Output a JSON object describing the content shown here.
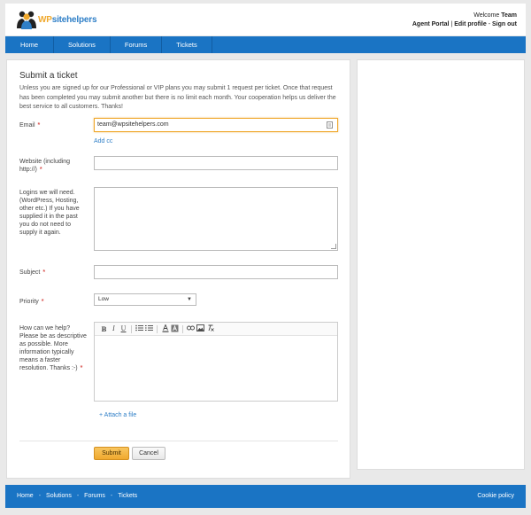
{
  "header": {
    "logo_wp": "WP",
    "logo_rest": "sitehelpers",
    "welcome_prefix": "Welcome",
    "welcome_user": "Team",
    "links": [
      "Agent Portal",
      "Edit profile",
      "Sign out"
    ],
    "link_sep": " | ",
    "link_sep2": " - "
  },
  "nav": {
    "items": [
      "Home",
      "Solutions",
      "Forums",
      "Tickets"
    ]
  },
  "form": {
    "title": "Submit a ticket",
    "intro": "Unless you are signed up for our Professional or VIP plans you may submit 1 request per ticket. Once that request has been completed you may submit another but there is no limit each month. Your cooperation helps us deliver the best service to all customers. Thanks!",
    "email_label": "Email",
    "email_value": "team@wpsitehelpers.com",
    "add_cc": "Add cc",
    "website_label": "Website (including http://)",
    "website_value": "",
    "logins_label": "Logins we will need. (WordPress, Hosting, other etc.) If you have supplied it in the past you do not need to supply it again.",
    "subject_label": "Subject",
    "priority_label": "Priority",
    "priority_value": "Low",
    "help_label": "How can we help? Please be as descriptive as possible. More information typically means a faster resolution. Thanks :-)",
    "required_mark": "*",
    "attach_label": "+ Attach a file",
    "submit_label": "Submit",
    "cancel_label": "Cancel",
    "toolbar": [
      "B",
      "I",
      "U"
    ]
  },
  "footer": {
    "links": [
      "Home",
      "Solutions",
      "Forums",
      "Tickets"
    ],
    "separator": "-",
    "cookie": "Cookie policy"
  },
  "colors": {
    "brand_blue": "#1a74c4",
    "accent_orange": "#f0a92e",
    "required_red": "#d9534f"
  }
}
